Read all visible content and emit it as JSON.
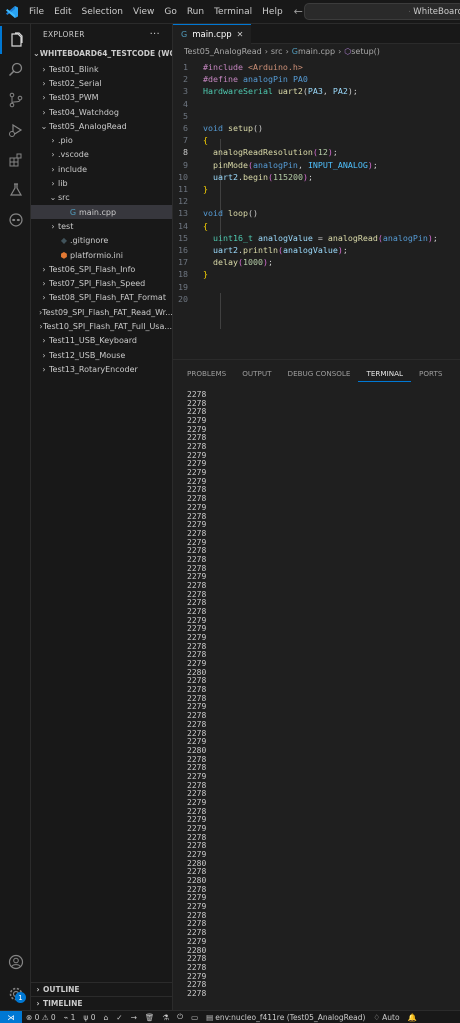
{
  "menu": [
    "File",
    "Edit",
    "Selection",
    "View",
    "Go",
    "Run",
    "Terminal",
    "Help"
  ],
  "command_center": "WhiteBoard",
  "explorer": {
    "title": "EXPLORER",
    "more": "···",
    "workspace": "WHITEBOARD64_TESTCODE (WORK...",
    "items": [
      {
        "label": "Test01_Blink",
        "chev": "›",
        "indent": 0
      },
      {
        "label": "Test02_Serial",
        "chev": "›",
        "indent": 0
      },
      {
        "label": "Test03_PWM",
        "chev": "›",
        "indent": 0
      },
      {
        "label": "Test04_Watchdog",
        "chev": "›",
        "indent": 0
      },
      {
        "label": "Test05_AnalogRead",
        "chev": "⌄",
        "indent": 0
      },
      {
        "label": ".pio",
        "chev": "›",
        "indent": 1
      },
      {
        "label": ".vscode",
        "chev": "›",
        "indent": 1
      },
      {
        "label": "include",
        "chev": "›",
        "indent": 1
      },
      {
        "label": "lib",
        "chev": "›",
        "indent": 1
      },
      {
        "label": "src",
        "chev": "⌄",
        "indent": 1
      },
      {
        "label": "main.cpp",
        "chev": "",
        "indent": 2,
        "icon": "cpp"
      },
      {
        "label": "test",
        "chev": "›",
        "indent": 1
      },
      {
        "label": ".gitignore",
        "chev": "",
        "indent": 1,
        "icon": "git"
      },
      {
        "label": "platformio.ini",
        "chev": "",
        "indent": 1,
        "icon": "pio"
      },
      {
        "label": "Test06_SPI_Flash_Info",
        "chev": "›",
        "indent": 0
      },
      {
        "label": "Test07_SPI_Flash_Speed",
        "chev": "›",
        "indent": 0
      },
      {
        "label": "Test08_SPI_Flash_FAT_Format",
        "chev": "›",
        "indent": 0
      },
      {
        "label": "Test09_SPI_Flash_FAT_Read_Wr...",
        "chev": "›",
        "indent": 0
      },
      {
        "label": "Test10_SPI_Flash_FAT_Full_Usa...",
        "chev": "›",
        "indent": 0
      },
      {
        "label": "Test11_USB_Keyboard",
        "chev": "›",
        "indent": 0
      },
      {
        "label": "Test12_USB_Mouse",
        "chev": "›",
        "indent": 0
      },
      {
        "label": "Test13_RotaryEncoder",
        "chev": "›",
        "indent": 0
      }
    ],
    "outline": "OUTLINE",
    "timeline": "TIMELINE"
  },
  "tab": {
    "label": "main.cpp",
    "close": "✕"
  },
  "breadcrumb": [
    "Test05_AnalogRead",
    "src",
    "main.cpp",
    "setup()"
  ],
  "editor": {
    "lines": [
      [
        [
          "pp",
          "#include "
        ],
        [
          "str",
          "<Arduino.h>"
        ]
      ],
      [
        [
          "pp",
          "#define "
        ],
        [
          "macro",
          "analogPin"
        ],
        [
          "code",
          " "
        ],
        [
          "macro",
          "PA0"
        ]
      ],
      [
        [
          "type",
          "HardwareSerial"
        ],
        [
          "code",
          " "
        ],
        [
          "fn",
          "uart2"
        ],
        [
          "code",
          "("
        ],
        [
          "var",
          "PA3"
        ],
        [
          "code",
          ", "
        ],
        [
          "var",
          "PA2"
        ],
        [
          "code",
          ");"
        ]
      ],
      [],
      [],
      [
        [
          "kw",
          "void"
        ],
        [
          "code",
          " "
        ],
        [
          "fn",
          "setup"
        ],
        [
          "code",
          "()"
        ]
      ],
      [
        [
          "br1",
          "{"
        ]
      ],
      [
        [
          "code",
          "  "
        ],
        [
          "fn",
          "analogReadResolution"
        ],
        [
          "br2",
          "("
        ],
        [
          "num",
          "12"
        ],
        [
          "br2",
          ")"
        ],
        [
          "code",
          ";"
        ]
      ],
      [
        [
          "code",
          "  "
        ],
        [
          "fn",
          "pinMode"
        ],
        [
          "br2",
          "("
        ],
        [
          "macro",
          "analogPin"
        ],
        [
          "code",
          ", "
        ],
        [
          "enm",
          "INPUT_ANALOG"
        ],
        [
          "br2",
          ")"
        ],
        [
          "code",
          ";"
        ]
      ],
      [
        [
          "code",
          "  "
        ],
        [
          "var",
          "uart2"
        ],
        [
          "code",
          "."
        ],
        [
          "fn",
          "begin"
        ],
        [
          "br2",
          "("
        ],
        [
          "num",
          "115200"
        ],
        [
          "br2",
          ")"
        ],
        [
          "code",
          ";"
        ]
      ],
      [
        [
          "br1",
          "}"
        ]
      ],
      [],
      [
        [
          "kw",
          "void"
        ],
        [
          "code",
          " "
        ],
        [
          "fn",
          "loop"
        ],
        [
          "code",
          "()"
        ]
      ],
      [
        [
          "br1",
          "{"
        ]
      ],
      [
        [
          "code",
          "  "
        ],
        [
          "type",
          "uint16_t"
        ],
        [
          "code",
          " "
        ],
        [
          "var",
          "analogValue"
        ],
        [
          "code",
          " = "
        ],
        [
          "fn",
          "analogRead"
        ],
        [
          "br2",
          "("
        ],
        [
          "macro",
          "analogPin"
        ],
        [
          "br2",
          ")"
        ],
        [
          "code",
          ";"
        ]
      ],
      [
        [
          "code",
          "  "
        ],
        [
          "var",
          "uart2"
        ],
        [
          "code",
          "."
        ],
        [
          "fn",
          "println"
        ],
        [
          "br2",
          "("
        ],
        [
          "var",
          "analogValue"
        ],
        [
          "br2",
          ")"
        ],
        [
          "code",
          ";"
        ]
      ],
      [
        [
          "code",
          "  "
        ],
        [
          "fn",
          "delay"
        ],
        [
          "br2",
          "("
        ],
        [
          "num",
          "1000"
        ],
        [
          "br2",
          ")"
        ],
        [
          "code",
          ";"
        ]
      ],
      [
        [
          "br1",
          "}"
        ]
      ],
      [],
      []
    ],
    "current_line": 8
  },
  "panel_tabs": [
    "PROBLEMS",
    "OUTPUT",
    "DEBUG CONSOLE",
    "TERMINAL",
    "PORTS"
  ],
  "active_panel_tab": "TERMINAL",
  "terminal_lines": [
    "2278",
    "2278",
    "2278",
    "2279",
    "2279",
    "2278",
    "2278",
    "2279",
    "2279",
    "2279",
    "2279",
    "2278",
    "2278",
    "2279",
    "2278",
    "2279",
    "2278",
    "2279",
    "2278",
    "2278",
    "2278",
    "2279",
    "2278",
    "2278",
    "2278",
    "2278",
    "2279",
    "2279",
    "2279",
    "2278",
    "2278",
    "2279",
    "2280",
    "2278",
    "2278",
    "2278",
    "2279",
    "2278",
    "2278",
    "2278",
    "2279",
    "2280",
    "2278",
    "2278",
    "2279",
    "2278",
    "2278",
    "2279",
    "2278",
    "2279",
    "2279",
    "2278",
    "2278",
    "2279",
    "2280",
    "2278",
    "2280",
    "2278",
    "2279",
    "2279",
    "2278",
    "2278",
    "2278",
    "2279",
    "2280",
    "2278",
    "2278",
    "2279",
    "2278",
    "2278"
  ],
  "status": {
    "remote": "⋊",
    "problems": "⊗ 0 ⚠ 0",
    "ports": "⌁ 1",
    "mirrors": "ψ 0",
    "env": "env:nucleo_f411re (Test05_AnalogRead)",
    "auto": "Auto",
    "account_badge": "1"
  },
  "colors": {
    "accent": "#0078d4",
    "background": "#1f1f1f",
    "sidebar": "#181818"
  }
}
